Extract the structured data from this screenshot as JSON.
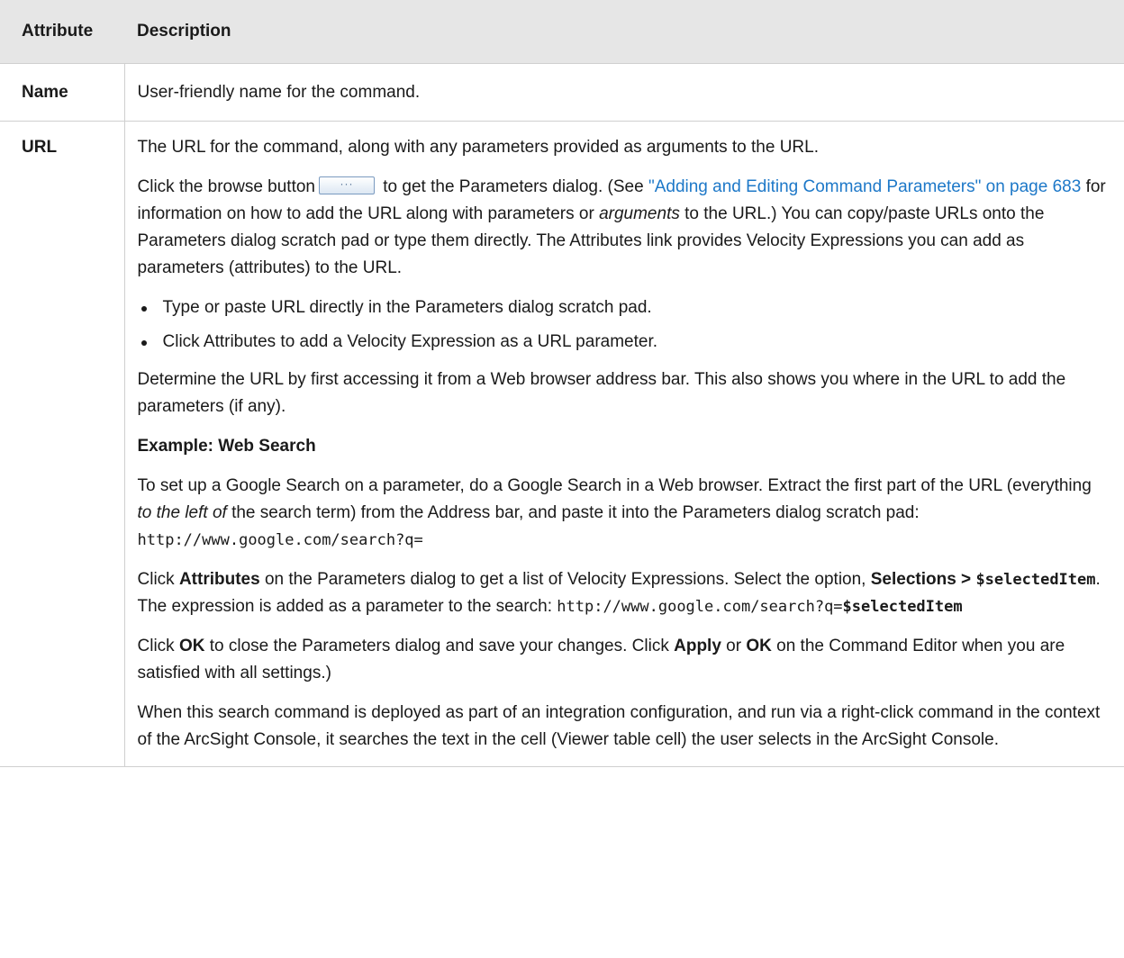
{
  "table": {
    "headers": {
      "attribute": "Attribute",
      "description": "Description"
    },
    "rows": {
      "name": {
        "attribute": "Name",
        "description": "User-friendly name for the command."
      },
      "url": {
        "attribute": "URL",
        "p1": "The URL for the command, along with any parameters provided as arguments to the URL.",
        "p2_a": "Click the browse button",
        "browse_button_label": "···",
        "p2_b": " to get the Parameters dialog. (See ",
        "p2_link": "\"Adding and Editing Command Parameters\" on page 683",
        "p2_c": " for information on how to add the URL along with parameters or ",
        "p2_italic": "arguments",
        "p2_d": " to the URL.) You can copy/paste URLs onto the Parameters dialog scratch pad or type them directly. The Attributes link provides Velocity Expressions you can add as parameters (attributes) to the URL.",
        "bullets": [
          "Type or paste URL directly in the Parameters dialog scratch pad.",
          "Click Attributes to add a Velocity Expression as a URL parameter."
        ],
        "p3": "Determine the URL by first accessing it from a Web browser address bar. This also shows you where in the URL to add the parameters (if any).",
        "example_heading": "Example: Web Search",
        "p4_a": "To set up a Google Search on a parameter, do a Google Search in a Web browser. Extract the first part of the URL (everything ",
        "p4_italic": "to the left of",
        "p4_b": " the search term) from the Address bar, and paste it into the Parameters dialog scratch pad: ",
        "p4_code": "http://www.google.com/search?q=",
        "p5_a": "Click ",
        "p5_bold1": "Attributes",
        "p5_b": " on the Parameters dialog to get a list of Velocity Expressions. Select the option, ",
        "p5_bold2": "Selections > ",
        "p5_bold2_code": "$selectedItem",
        "p5_c": ". The expression is added as a parameter to the search: ",
        "p5_code": "http://www.google.com/search?q=",
        "p5_code_bold": "$selectedItem",
        "p6_a": "Click ",
        "p6_ok1": "OK",
        "p6_b": " to close the Parameters dialog and save your changes. Click ",
        "p6_apply": "Apply",
        "p6_c": " or ",
        "p6_ok2": "OK",
        "p6_d": " on the Command Editor when you are satisfied with all settings.)",
        "p7": "When this search command is deployed as part of an integration configuration, and run via a right-click command in the context of the ArcSight Console, it searches the text in the cell (Viewer table cell) the user selects in the ArcSight Console."
      }
    }
  }
}
